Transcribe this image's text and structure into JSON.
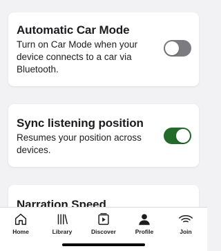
{
  "settings": {
    "car_mode": {
      "title": "Automatic Car Mode",
      "description": "Turn on Car Mode when your device connects to a car via Bluetooth.",
      "enabled": false
    },
    "sync_position": {
      "title": "Sync listening position",
      "description": "Resumes your position across devices.",
      "enabled": true
    },
    "narration_speed": {
      "title": "Narration Speed"
    }
  },
  "tabbar": {
    "home": "Home",
    "library": "Library",
    "discover": "Discover",
    "profile": "Profile",
    "join": "Join",
    "active": "profile"
  },
  "colors": {
    "toggle_on": "#246b2b",
    "toggle_off": "#7b7b80",
    "background": "#f2f2f5"
  }
}
